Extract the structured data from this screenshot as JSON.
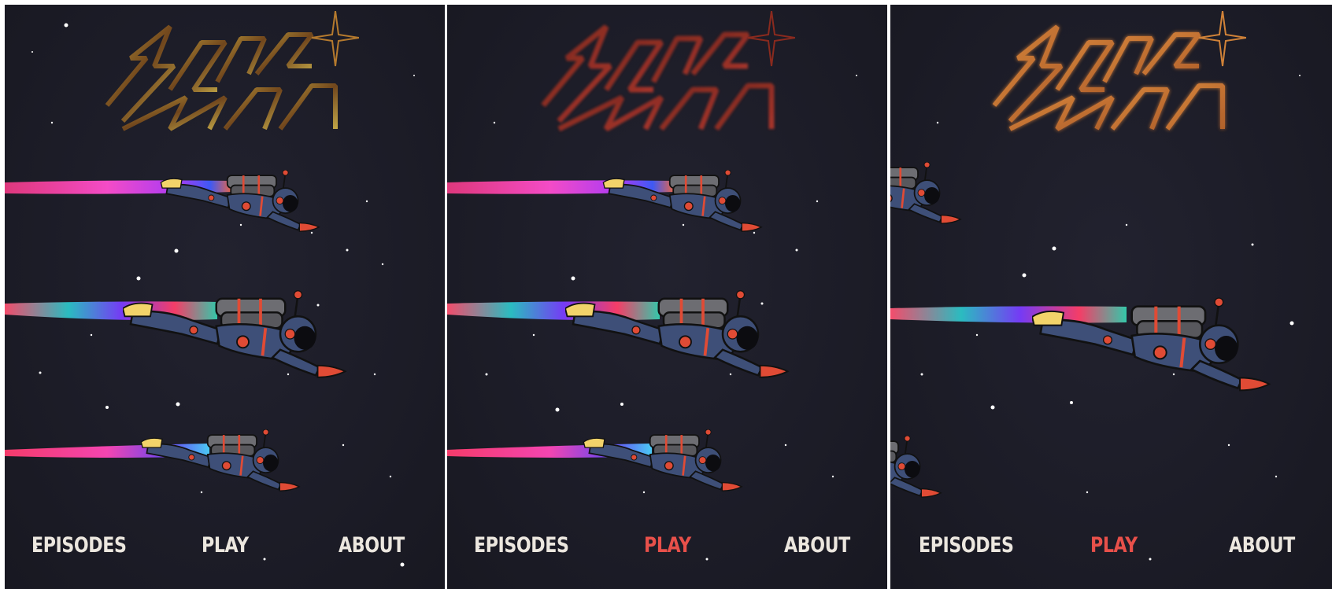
{
  "game": {
    "logo_text": "SPACE ZERO",
    "colors": {
      "background": "#1c1c27",
      "nav_text": "#ece7df",
      "nav_active": "#e8504a",
      "suit": "#3e4f78",
      "accent": "#e04b35"
    }
  },
  "panels": [
    {
      "nav": {
        "episodes_label": "EPISODES",
        "play_label": "PLAY",
        "about_label": "ABOUT",
        "active_item": "none"
      },
      "logo_style": "glitch-gold"
    },
    {
      "nav": {
        "episodes_label": "EPISODES",
        "play_label": "PLAY",
        "about_label": "ABOUT",
        "active_item": "play"
      },
      "logo_style": "blurred-red"
    },
    {
      "nav": {
        "episodes_label": "EPISODES",
        "play_label": "PLAY",
        "about_label": "ABOUT",
        "active_item": "play"
      },
      "logo_style": "glow-orange"
    }
  ]
}
